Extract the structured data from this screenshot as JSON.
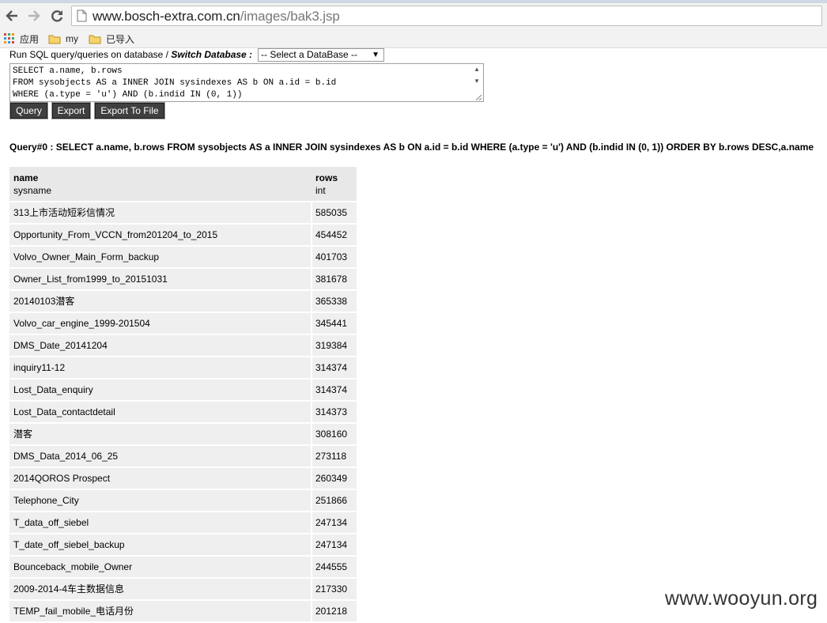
{
  "browser": {
    "url_host": "www.bosch-extra.com.cn",
    "url_path": "/images/bak3.jsp",
    "bookmarks": [
      {
        "label": "应用",
        "icon": "apps-grid-icon"
      },
      {
        "label": "my",
        "icon": "folder-icon"
      },
      {
        "label": "已导入",
        "icon": "folder-icon"
      }
    ]
  },
  "page": {
    "run_label": "Run SQL query/queries on database / ",
    "switch_label": "Switch Database :",
    "db_select_value": "-- Select a DataBase --",
    "sql_lines": [
      "SELECT a.name, b.rows",
      "FROM sysobjects AS a INNER JOIN sysindexes AS b ON a.id = b.id",
      "WHERE (a.type = 'u') AND (b.indid IN (0, 1))"
    ],
    "buttons": {
      "query": "Query",
      "export": "Export",
      "export_file": "Export To File"
    },
    "query_title": "Query#0 : SELECT a.name, b.rows FROM sysobjects AS a INNER JOIN sysindexes AS b ON a.id = b.id WHERE (a.type = 'u') AND (b.indid IN (0, 1)) ORDER BY b.rows DESC,a.name"
  },
  "table": {
    "columns": [
      {
        "name": "name",
        "type": "sysname"
      },
      {
        "name": "rows",
        "type": "int"
      }
    ],
    "rows": [
      [
        "313上市活动短彩信情况",
        "585035"
      ],
      [
        "Opportunity_From_VCCN_from201204_to_2015",
        "454452"
      ],
      [
        "Volvo_Owner_Main_Form_backup",
        "401703"
      ],
      [
        "Owner_List_from1999_to_20151031",
        "381678"
      ],
      [
        "20140103潜客",
        "365338"
      ],
      [
        "Volvo_car_engine_1999-201504",
        "345441"
      ],
      [
        "DMS_Date_20141204",
        "319384"
      ],
      [
        "inquiry11-12",
        "314374"
      ],
      [
        "Lost_Data_enquiry",
        "314374"
      ],
      [
        "Lost_Data_contactdetail",
        "314373"
      ],
      [
        "潜客",
        "308160"
      ],
      [
        "DMS_Data_2014_06_25",
        "273118"
      ],
      [
        "2014QOROS Prospect",
        "260349"
      ],
      [
        "Telephone_City",
        "251866"
      ],
      [
        "T_data_off_siebel",
        "247134"
      ],
      [
        "T_date_off_siebel_backup",
        "247134"
      ],
      [
        "Bounceback_mobile_Owner",
        "244555"
      ],
      [
        "2009-2014-4车主数据信息",
        "217330"
      ],
      [
        "TEMP_fail_mobile_电话月份",
        "201218"
      ]
    ]
  },
  "watermark": "www.wooyun.org"
}
